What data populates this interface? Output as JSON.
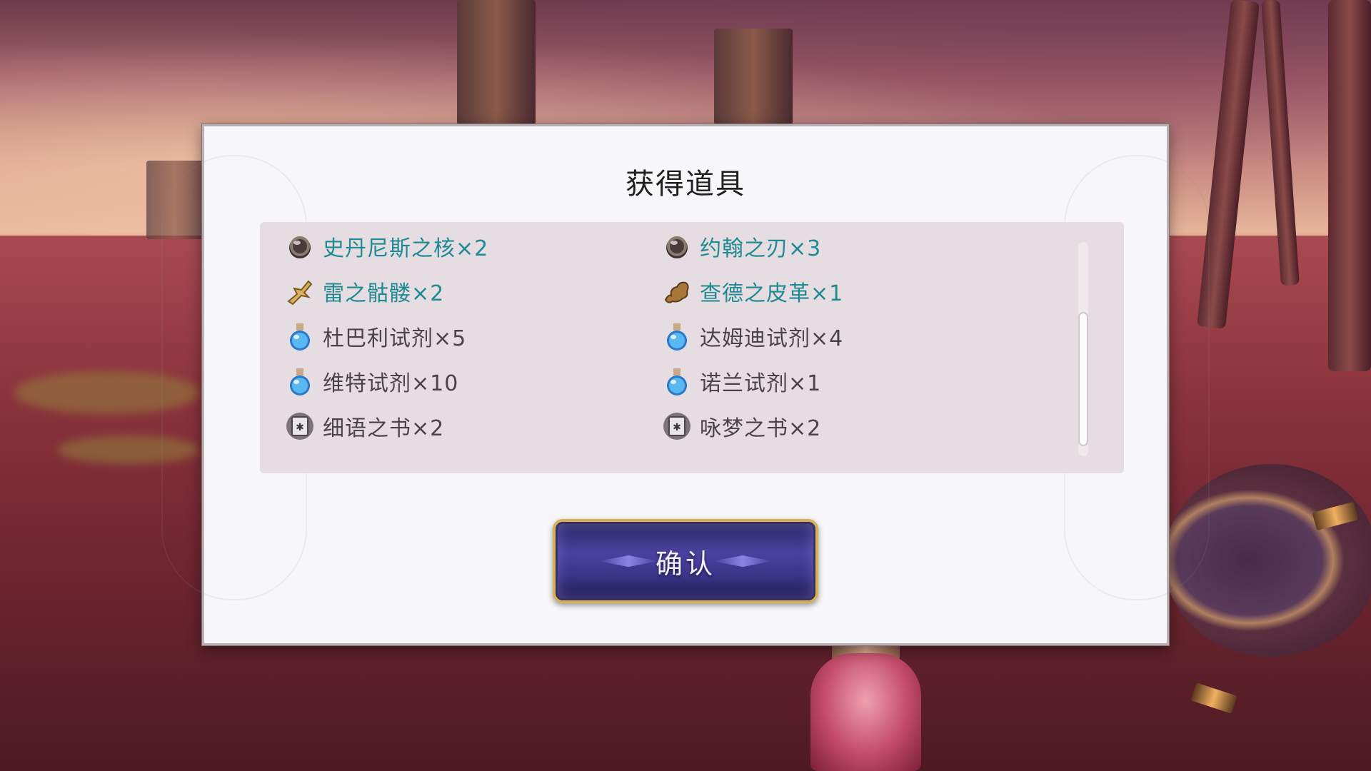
{
  "dialog": {
    "title": "获得道具",
    "confirm_label": "确认"
  },
  "items": [
    {
      "label": "史丹尼斯之核×2",
      "icon": "orb-icon",
      "rarity": "rare"
    },
    {
      "label": "约翰之刃×3",
      "icon": "orb-icon",
      "rarity": "rare"
    },
    {
      "label": "雷之骷髅×2",
      "icon": "bone-icon",
      "rarity": "rare"
    },
    {
      "label": "查德之皮革×1",
      "icon": "leather-icon",
      "rarity": "rare"
    },
    {
      "label": "杜巴利试剂×5",
      "icon": "potion-icon",
      "rarity": "normal"
    },
    {
      "label": "达姆迪试剂×4",
      "icon": "potion-icon",
      "rarity": "normal"
    },
    {
      "label": "维特试剂×10",
      "icon": "potion-icon",
      "rarity": "normal"
    },
    {
      "label": "诺兰试剂×1",
      "icon": "potion-icon",
      "rarity": "normal"
    },
    {
      "label": "细语之书×2",
      "icon": "book-icon",
      "rarity": "normal"
    },
    {
      "label": "咏梦之书×2",
      "icon": "book-icon",
      "rarity": "normal"
    }
  ],
  "colors": {
    "rare_text": "#1f8a92",
    "normal_text": "#4a4347",
    "button_border": "#d5b15a"
  }
}
